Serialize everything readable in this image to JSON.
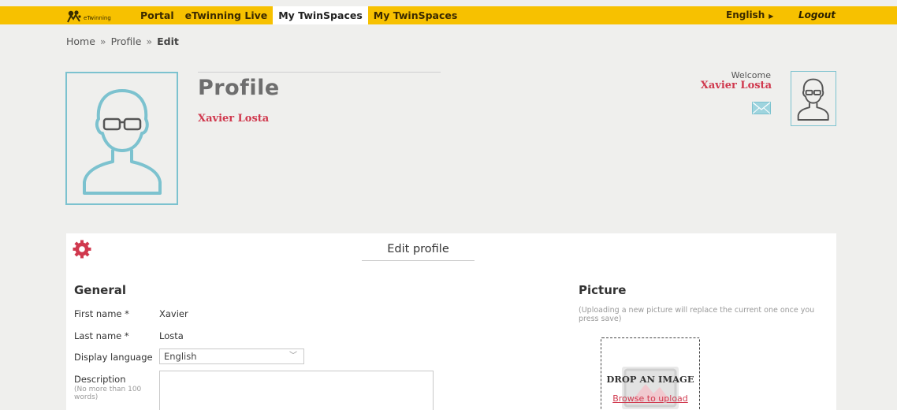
{
  "topbar": {
    "logo_text": "eTwinning",
    "nav": [
      "Portal",
      "eTwinning Live",
      "My TwinSpaces",
      "My TwinSpaces"
    ],
    "active_index": 2,
    "language": "English",
    "logout": "Logout",
    "color": "#f7c100"
  },
  "breadcrumb": {
    "home": "Home",
    "profile": "Profile",
    "current": "Edit",
    "separator": "»"
  },
  "profile": {
    "title": "Profile",
    "name": "Xavier Losta"
  },
  "welcome": {
    "label": "Welcome",
    "name": "Xavier Losta"
  },
  "edit": {
    "title": "Edit profile",
    "general": {
      "heading": "General",
      "first_name_label": "First name *",
      "first_name_value": "Xavier",
      "last_name_label": "Last name *",
      "last_name_value": "Losta",
      "display_language_label": "Display language",
      "display_language_value": "English",
      "description_label": "Description",
      "description_hint": "(No more than 100 words)",
      "description_value": ""
    },
    "picture": {
      "heading": "Picture",
      "note": "(Uploading a new picture will replace the current one once you press save)",
      "drop_text": "DROP AN IMAGE",
      "browse_text": "Browse to upload"
    }
  },
  "colors": {
    "accent_red": "#d0394e",
    "avatar_teal": "#7cc2cf"
  }
}
